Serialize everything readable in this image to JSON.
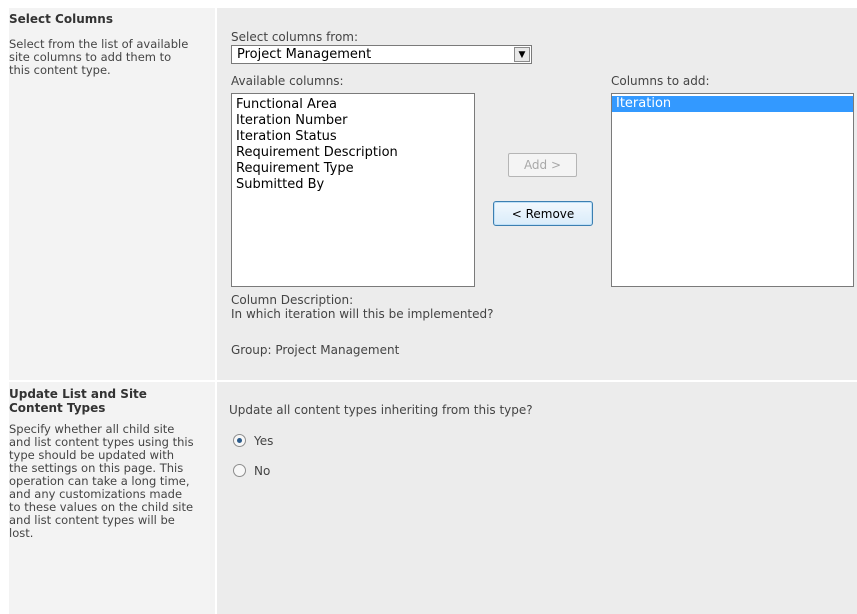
{
  "select_columns": {
    "title": "Select Columns",
    "description": "Select from the list of available site columns to add them to this content type.",
    "select_from_label": "Select columns from:",
    "select_from_value": "Project Management",
    "available_label": "Available columns:",
    "available_columns": [
      "Functional Area",
      "Iteration Number",
      "Iteration Status",
      "Requirement Description",
      "Requirement Type",
      "Submitted By"
    ],
    "to_add_label": "Columns to add:",
    "columns_to_add": [
      "Iteration"
    ],
    "add_button": "Add >",
    "remove_button": "< Remove",
    "column_description_label": "Column Description:",
    "column_description": "In which iteration will this be implemented?",
    "group": "Group: Project Management"
  },
  "update_types": {
    "title_line1": "Update List and Site",
    "title_line2": "Content Types",
    "description": "Specify whether all child site and list content types using this type should be updated with the settings on this page. This operation can take a long time, and any customizations made to these values on the child site and list content types will be lost.",
    "question": "Update all content types inheriting from this type?",
    "options": [
      {
        "label": "Yes",
        "checked": true
      },
      {
        "label": "No",
        "checked": false
      }
    ]
  }
}
